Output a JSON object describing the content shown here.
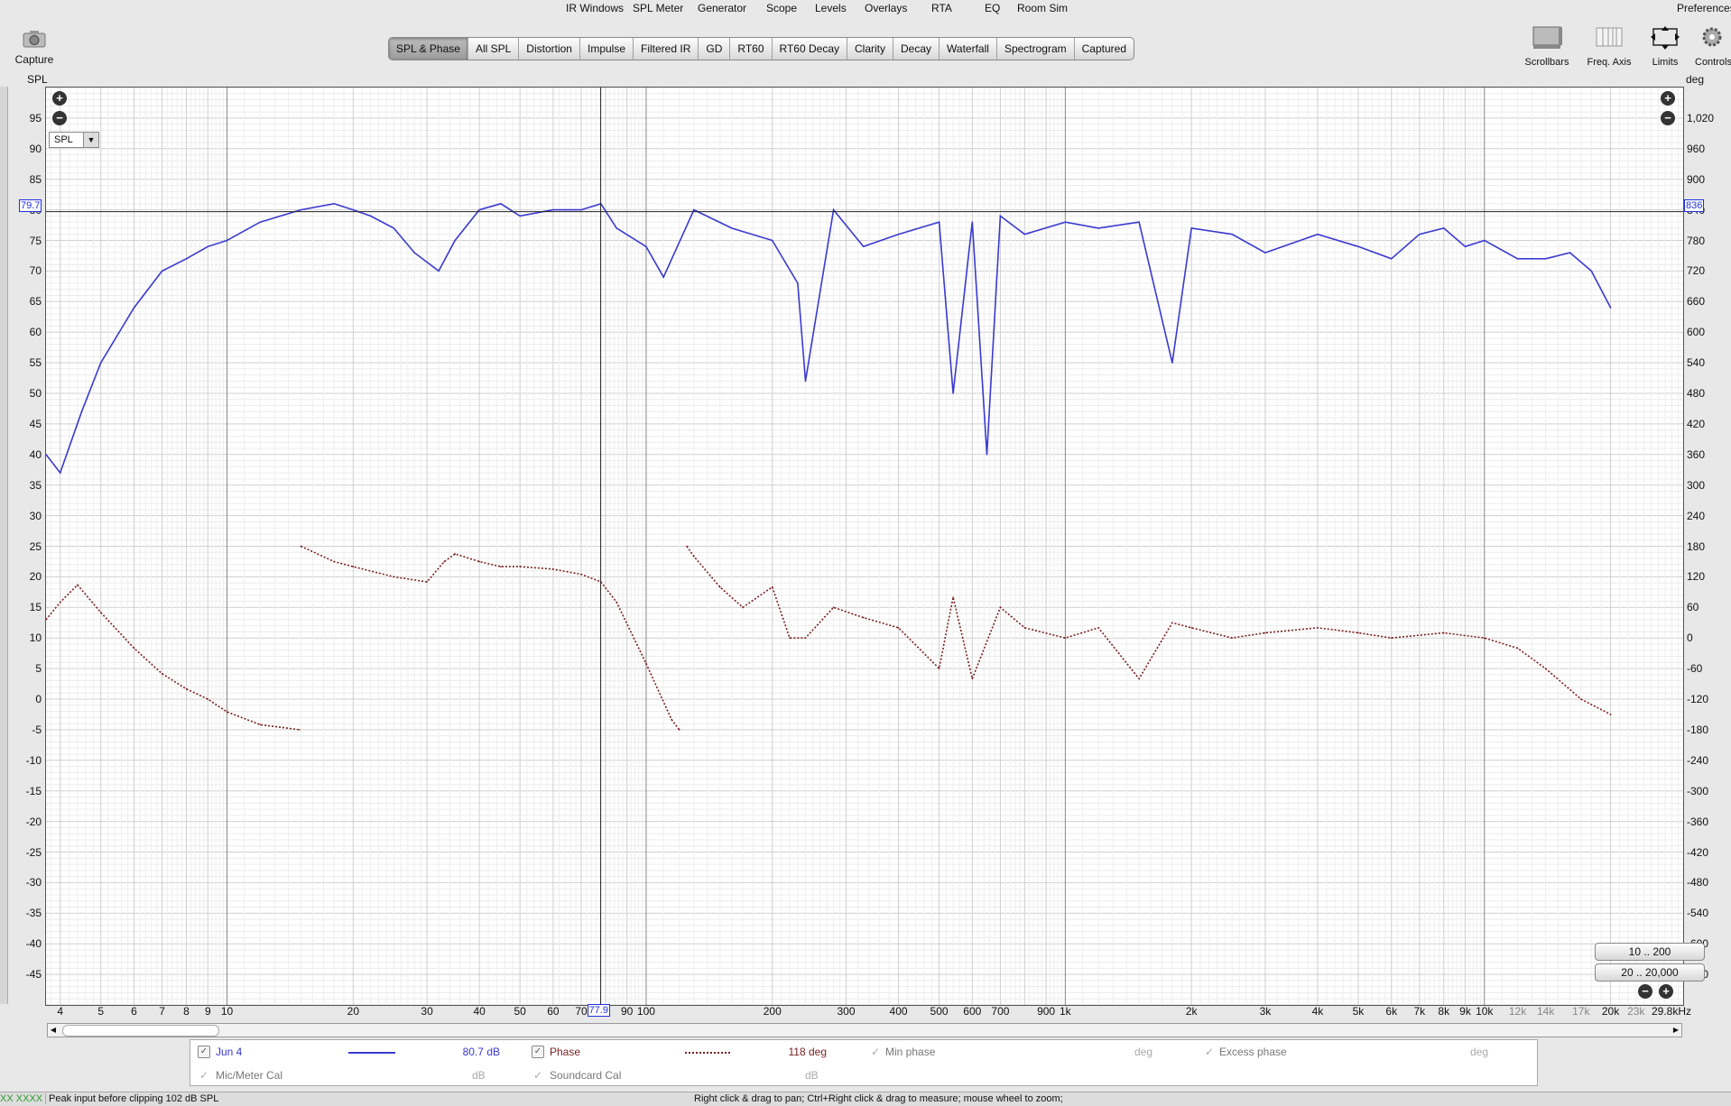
{
  "menu": [
    {
      "label": "IR Windows",
      "x": 627
    },
    {
      "label": "SPL Meter",
      "x": 701
    },
    {
      "label": "Generator",
      "x": 773
    },
    {
      "label": "Scope",
      "x": 849
    },
    {
      "label": "Levels",
      "x": 903
    },
    {
      "label": "Overlays",
      "x": 958
    },
    {
      "label": "RTA",
      "x": 1032
    },
    {
      "label": "EQ",
      "x": 1091
    },
    {
      "label": "Room Sim",
      "x": 1127
    },
    {
      "label": "Preferences",
      "x": 1858
    }
  ],
  "capture_label": "Capture",
  "tools": {
    "scrollbars": "Scrollbars",
    "freq_axis": "Freq. Axis",
    "limits": "Limits",
    "controls": "Controls"
  },
  "tabs": [
    {
      "label": "SPL & Phase",
      "active": true
    },
    {
      "label": "All SPL"
    },
    {
      "label": "Distortion"
    },
    {
      "label": "Impulse"
    },
    {
      "label": "Filtered IR"
    },
    {
      "label": "GD"
    },
    {
      "label": "RT60"
    },
    {
      "label": "RT60 Decay"
    },
    {
      "label": "Clarity"
    },
    {
      "label": "Decay"
    },
    {
      "label": "Waterfall"
    },
    {
      "label": "Spectrogram"
    },
    {
      "label": "Captured"
    }
  ],
  "axis": {
    "left_unit": "SPL",
    "right_unit": "deg",
    "freq_unit": "29.8kHz",
    "spl_selector": "SPL"
  },
  "spl_ticks": [
    "95",
    "90",
    "85",
    "80",
    "75",
    "70",
    "65",
    "60",
    "55",
    "50",
    "45",
    "40",
    "35",
    "30",
    "25",
    "20",
    "15",
    "10",
    "5",
    "0",
    "-5",
    "-10",
    "-15",
    "-20",
    "-25",
    "-30",
    "-35",
    "-40",
    "-45"
  ],
  "deg_ticks": [
    "1,020",
    "960",
    "900",
    "840",
    "780",
    "720",
    "660",
    "600",
    "540",
    "480",
    "420",
    "360",
    "300",
    "240",
    "180",
    "120",
    "60",
    "0",
    "-60",
    "-120",
    "-180",
    "-240",
    "-300",
    "-360",
    "-420",
    "-480",
    "-540",
    "-600",
    "-660"
  ],
  "freq_ticks": [
    {
      "f": 4,
      "t": "4"
    },
    {
      "f": 5,
      "t": "5"
    },
    {
      "f": 6,
      "t": "6"
    },
    {
      "f": 7,
      "t": "7"
    },
    {
      "f": 8,
      "t": "8"
    },
    {
      "f": 9,
      "t": "9"
    },
    {
      "f": 10,
      "t": "10"
    },
    {
      "f": 20,
      "t": "20"
    },
    {
      "f": 30,
      "t": "30"
    },
    {
      "f": 40,
      "t": "40"
    },
    {
      "f": 50,
      "t": "50"
    },
    {
      "f": 60,
      "t": "60"
    },
    {
      "f": 70,
      "t": "70"
    },
    {
      "f": 90,
      "t": "90"
    },
    {
      "f": 100,
      "t": "100"
    },
    {
      "f": 200,
      "t": "200"
    },
    {
      "f": 300,
      "t": "300"
    },
    {
      "f": 400,
      "t": "400"
    },
    {
      "f": 500,
      "t": "500"
    },
    {
      "f": 600,
      "t": "600"
    },
    {
      "f": 700,
      "t": "700"
    },
    {
      "f": 900,
      "t": "900"
    },
    {
      "f": 1000,
      "t": "1k"
    },
    {
      "f": 2000,
      "t": "2k"
    },
    {
      "f": 3000,
      "t": "3k"
    },
    {
      "f": 4000,
      "t": "4k"
    },
    {
      "f": 5000,
      "t": "5k"
    },
    {
      "f": 6000,
      "t": "6k"
    },
    {
      "f": 7000,
      "t": "7k"
    },
    {
      "f": 8000,
      "t": "8k"
    },
    {
      "f": 9000,
      "t": "9k"
    },
    {
      "f": 10000,
      "t": "10k"
    },
    {
      "f": 12000,
      "t": "12k",
      "grey": true
    },
    {
      "f": 14000,
      "t": "14k",
      "grey": true
    },
    {
      "f": 17000,
      "t": "17k",
      "grey": true
    },
    {
      "f": 20000,
      "t": "20k"
    },
    {
      "f": 23000,
      "t": "23k",
      "grey": true
    }
  ],
  "cursor": {
    "spl": "79.7",
    "deg": "836",
    "freq": "77.9"
  },
  "range_buttons": {
    "r1": "10 .. 200",
    "r2": "20 .. 20,000"
  },
  "legend": {
    "jun4": "Jun 4",
    "jun4_value": "80.7 dB",
    "phase": "Phase",
    "phase_value": "118 deg",
    "min_phase": "Min phase",
    "min_phase_unit": "deg",
    "excess_phase": "Excess phase",
    "excess_phase_unit": "deg",
    "mic_cal": "Mic/Meter Cal",
    "mic_cal_unit": "dB",
    "soundcard_cal": "Soundcard Cal",
    "soundcard_cal_unit": "dB"
  },
  "status": {
    "left_code": "XX XXXX",
    "peak": "Peak input before clipping 102 dB SPL",
    "hint": "Right click & drag to pan; Ctrl+Right click & drag to measure; mouse wheel to zoom;"
  },
  "colors": {
    "spl": "#3a3ad0",
    "phase": "#7a1f1f",
    "cursor": "#2030e0"
  },
  "chart_data": {
    "type": "line",
    "xscale": "log",
    "xlim": [
      3.7,
      29800
    ],
    "ylim": [
      -50,
      100
    ],
    "y2lim": [
      -720,
      1080
    ],
    "series": [
      {
        "name": "Jun 4",
        "axis": "SPL",
        "x": [
          3.7,
          4,
          4.5,
          5,
          6,
          7,
          8,
          9,
          10,
          12,
          15,
          18,
          20,
          22,
          25,
          28,
          32,
          35,
          40,
          45,
          50,
          60,
          70,
          78,
          85,
          100,
          110,
          130,
          160,
          200,
          230,
          240,
          280,
          330,
          400,
          500,
          540,
          600,
          650,
          700,
          800,
          1000,
          1200,
          1500,
          1800,
          2000,
          2500,
          3000,
          4000,
          5000,
          6000,
          7000,
          8000,
          9000,
          10000,
          12000,
          14000,
          16000,
          18000,
          20000
        ],
        "y": [
          40,
          37,
          47,
          55,
          64,
          70,
          72,
          74,
          75,
          78,
          80,
          81,
          80,
          79,
          77,
          73,
          70,
          75,
          80,
          81,
          79,
          80,
          80,
          81,
          77,
          74,
          69,
          80,
          77,
          75,
          68,
          52,
          80,
          74,
          76,
          78,
          50,
          78,
          40,
          79,
          76,
          78,
          77,
          78,
          55,
          77,
          76,
          73,
          76,
          74,
          72,
          76,
          77,
          74,
          75,
          72,
          72,
          73,
          70,
          64
        ]
      },
      {
        "name": "Phase",
        "axis": "deg",
        "x": [
          3.7,
          4,
          4.4,
          5,
          6,
          7,
          8,
          9,
          10,
          12,
          14.9,
          15,
          18,
          20,
          25,
          30,
          33,
          35,
          40,
          45,
          50,
          60,
          70,
          78,
          85,
          100,
          115,
          120,
          125,
          130,
          150,
          170,
          200,
          220,
          240,
          280,
          330,
          400,
          500,
          540,
          600,
          700,
          800,
          1000,
          1200,
          1500,
          1800,
          2000,
          2500,
          3000,
          4000,
          5000,
          6000,
          8000,
          10000,
          12000,
          14000,
          17000,
          20000
        ],
        "y": [
          36,
          70,
          104,
          50,
          -20,
          -70,
          -100,
          -120,
          -145,
          -170,
          -180,
          180,
          150,
          140,
          120,
          110,
          150,
          165,
          150,
          140,
          140,
          135,
          125,
          110,
          70,
          -50,
          -160,
          -180,
          180,
          160,
          100,
          60,
          100,
          0,
          0,
          60,
          40,
          20,
          -60,
          80,
          -80,
          60,
          20,
          0,
          20,
          -80,
          30,
          20,
          0,
          10,
          20,
          10,
          0,
          10,
          0,
          -20,
          -60,
          -120,
          -150
        ]
      }
    ]
  }
}
